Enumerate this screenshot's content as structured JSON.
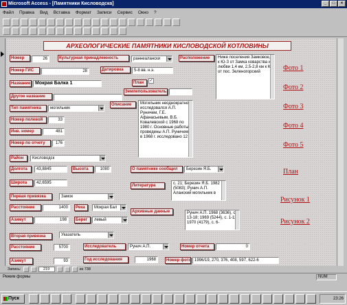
{
  "window": {
    "title": "Microsoft Access - [Памятники Кисловодска]",
    "min": "_",
    "max": "□",
    "close": "×"
  },
  "menu": [
    "Файл",
    "Правка",
    "Вид",
    "Вставка",
    "Формат",
    "Записи",
    "Сервис",
    "Окно",
    "?"
  ],
  "form": {
    "heading": "АРХЕОЛОГИЧЕСКИЕ ПАМЯТНИКИ КИСЛОВОДСКОЙ КОТЛОВИНЫ",
    "nomer_label": "Номер",
    "nomer_value": "26",
    "kult_label": "Культурная принадлежность",
    "kult_value": "раннеалански",
    "raspol_label": "Расположение",
    "raspol_text": "Ниже поселения Замковое, к Ю-З от Замка коварства и любви 1,4 км, 2,5-2,8 км к Ю от пос. Зеленогорский",
    "gis_label": "Номер ГИС",
    "gis_value": "28",
    "dat_label": "Датировка",
    "dat_value": "5-8 вв. н.э.",
    "name_label": "Название",
    "name_value": "Мокрая Балка 1",
    "plan_label": "План",
    "plan_check": "✓",
    "other_name_label": "Другое название",
    "other_name_value": "",
    "zemle_label": "Землепользователь",
    "zemle_value": "",
    "type_label": "Тип памятника",
    "type_value": "могильник",
    "opis_label": "Описание",
    "opis_text": "Могильник неоднократно исследовался А.П. Руничем, Г.Е. Афанасьевым, В.Б. Ковалевской с 1968 по 1980 г. Основные работы проведены А.П. Руничем; в 1968 г. исследовано 12",
    "polevoi_label": "Номер полевой",
    "polevoi_value": "33",
    "inv_label": "Инв. номер",
    "inv_value": "481",
    "otchet_label": "Номер по отчету",
    "otchet_value": "176",
    "raion_label": "Район",
    "raion_value": "Кисловодск",
    "dolgota_label": "Долгота",
    "dolgota_value": "43,8845",
    "vysota_label": "Высота",
    "vysota_value": "1080",
    "soobsh_label": "О памятнике сообщил",
    "soobsh_value": "Березин Я.Б.",
    "shirota_label": "Широта",
    "shirota_value": "42,6595",
    "lit_label": "Литература",
    "lit_text": "с. 21; Березин Я.Б. 1982 (5083); Рунич А.П. Аланский могильник в",
    "priv1_label": "Первая привязка",
    "priv1_value": "Замок",
    "rast1_label": "Расстояние",
    "rast1_value": "1400",
    "reka_label": "Река",
    "reka_value": "Мокрая Бал",
    "azim1_label": "Азимут",
    "azim1_value": "198",
    "bereg_label": "Берег",
    "bereg_value": "левый",
    "arch_label": "Архивные данные",
    "arch_text": "Рунич А.П. 1968 (3636), с. 13-18; 1969 (5244), с. 1-11; 1970 (4179), с. 6-",
    "priv2_label": "Вторая привязка",
    "priv2_value": "Указатель",
    "rast2_label": "Расстояние",
    "rast2_value": "5700",
    "issl_label": "Исследователь",
    "issl_value": "Рунич А.П.",
    "nomotch_label": "Номер отчета",
    "nomotch_value": "0",
    "azim2_label": "Азимут",
    "azim2_value": "93",
    "god_label": "Год исследования",
    "god_value": "1968",
    "foto_label": "Номер фото",
    "foto_value": "1996/19, 270, 376, 408, 597, 622-6",
    "links": [
      "Фото 1",
      "Фото 2",
      "Фото 3",
      "Фото 4",
      "Фото 5",
      "План",
      "Рисунок 1",
      "Рисунок 2"
    ]
  },
  "nav": {
    "label": "Запись:",
    "current": "219",
    "total": "из 738"
  },
  "status": {
    "text": "Режим формы",
    "num": "NUM"
  },
  "taskbar": {
    "start": "Пуск",
    "clock": "23:26"
  }
}
